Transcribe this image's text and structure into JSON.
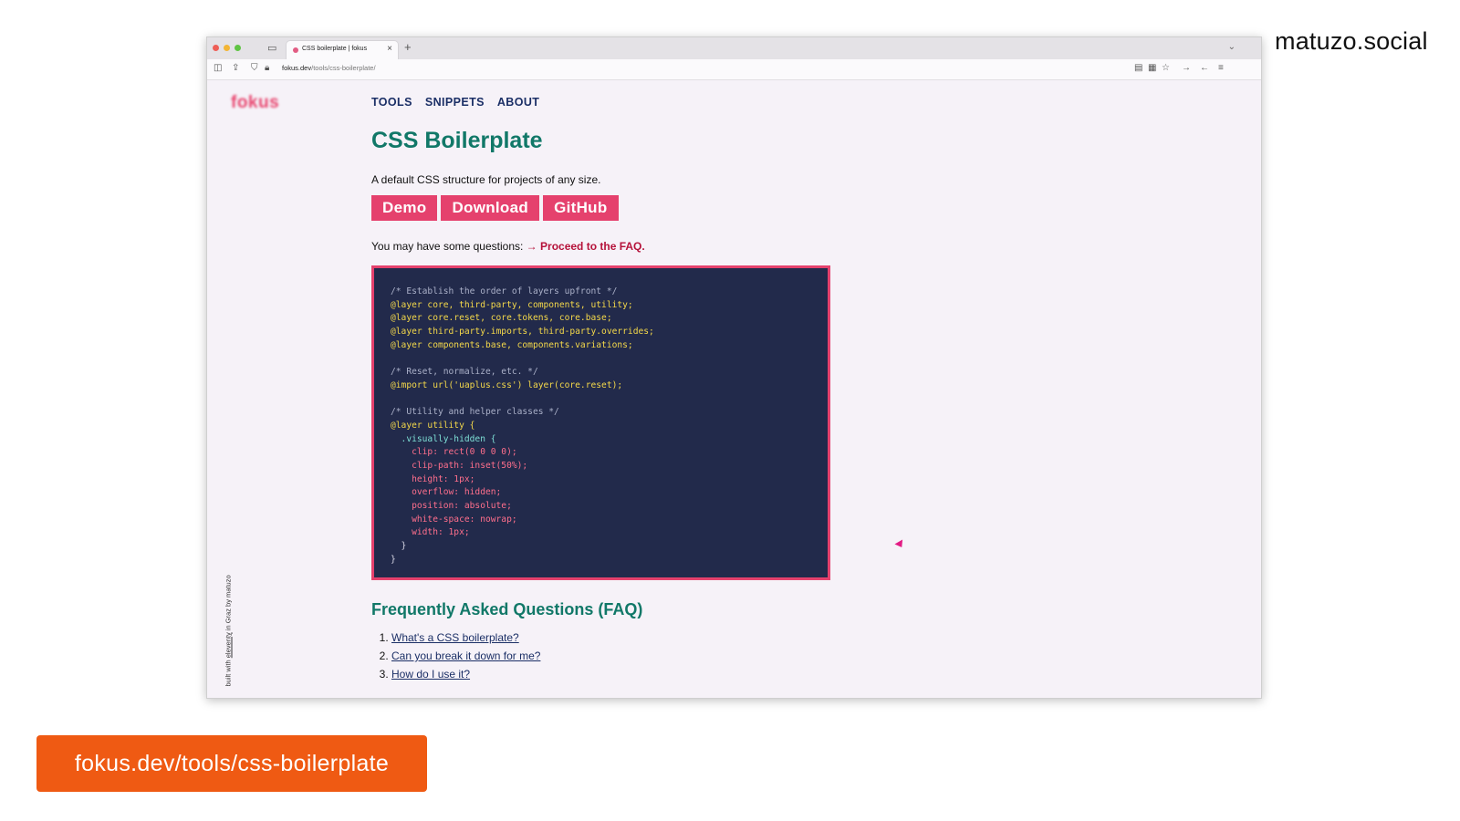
{
  "brand_handle": "matuzo.social",
  "url_banner": "fokus.dev/tools/css-boilerplate",
  "browser": {
    "tab_title": "CSS boilerplate | fokus",
    "tab_close": "×",
    "new_tab": "+",
    "address_host": "fokus.dev",
    "address_path": "/tools/css-boilerplate/"
  },
  "site": {
    "logo": "fokus",
    "side_credit_prefix": "built with ",
    "side_credit_link": "eleventy",
    "side_credit_suffix": " in Graz by matuzo",
    "nav": [
      "TOOLS",
      "SNIPPETS",
      "ABOUT"
    ]
  },
  "main": {
    "title": "CSS Boilerplate",
    "tagline": "A default CSS structure for projects of any size.",
    "buttons": [
      "Demo",
      "Download",
      "GitHub"
    ],
    "questions_prefix": "You may have some questions: ",
    "questions_arrow": "→",
    "questions_link": "Proceed to the FAQ."
  },
  "code": [
    {
      "text": "/* Establish the order of layers upfront */",
      "kind": "comment"
    },
    {
      "text": "@layer core, third-party, components, utility;",
      "kind": "atrule"
    },
    {
      "text": "@layer core.reset, core.tokens, core.base;",
      "kind": "atrule"
    },
    {
      "text": "@layer third-party.imports, third-party.overrides;",
      "kind": "atrule"
    },
    {
      "text": "@layer components.base, components.variations;",
      "kind": "atrule"
    },
    {
      "text": "",
      "kind": "plain"
    },
    {
      "text": "/* Reset, normalize, etc. */",
      "kind": "comment"
    },
    {
      "text": "@import url('uaplus.css') layer(core.reset);",
      "kind": "atrule"
    },
    {
      "text": "",
      "kind": "plain"
    },
    {
      "text": "/* Utility and helper classes */",
      "kind": "comment"
    },
    {
      "text": "@layer utility {",
      "kind": "atrule"
    },
    {
      "text": "  .visually-hidden {",
      "kind": "selector"
    },
    {
      "text": "    clip: rect(0 0 0 0);",
      "kind": "prop"
    },
    {
      "text": "    clip-path: inset(50%);",
      "kind": "prop"
    },
    {
      "text": "    height: 1px;",
      "kind": "prop"
    },
    {
      "text": "    overflow: hidden;",
      "kind": "prop"
    },
    {
      "text": "    position: absolute;",
      "kind": "prop"
    },
    {
      "text": "    white-space: nowrap;",
      "kind": "prop"
    },
    {
      "text": "    width: 1px;",
      "kind": "prop"
    },
    {
      "text": "  }",
      "kind": "plain"
    },
    {
      "text": "}",
      "kind": "plain"
    }
  ],
  "faq": {
    "heading": "Frequently Asked Questions (FAQ)",
    "items": [
      "What's a CSS boilerplate?",
      "Can you break it down for me?",
      "How do I use it?"
    ]
  },
  "colors": {
    "accent": "#e5416d",
    "heading": "#117868",
    "code_bg": "#222a4b",
    "banner": "#ef5a13"
  }
}
